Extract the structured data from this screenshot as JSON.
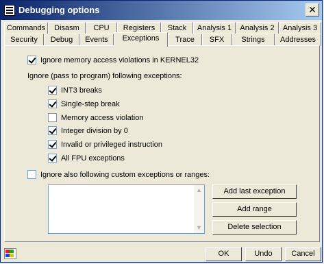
{
  "window": {
    "title": "Debugging options",
    "close_glyph": "✕"
  },
  "tabs_row1": [
    "Commands",
    "Disasm",
    "CPU",
    "Registers",
    "Stack",
    "Analysis 1",
    "Analysis 2",
    "Analysis 3"
  ],
  "tabs_row2": [
    "Security",
    "Debug",
    "Events",
    "Exceptions",
    "Trace",
    "SFX",
    "Strings",
    "Addresses"
  ],
  "active_tab": "Exceptions",
  "exceptions": {
    "ignore_kernel32": {
      "label": "Ignore memory access violations in KERNEL32",
      "checked": true
    },
    "ignore_heading": "Ignore (pass to program) following exceptions:",
    "items": [
      {
        "label": "INT3 breaks",
        "checked": true
      },
      {
        "label": "Single-step break",
        "checked": true
      },
      {
        "label": "Memory access violation",
        "checked": false
      },
      {
        "label": "Integer division by 0",
        "checked": true
      },
      {
        "label": "Invalid or privileged instruction",
        "checked": true
      },
      {
        "label": "All FPU exceptions",
        "checked": true
      }
    ],
    "ignore_custom": {
      "label": "Ignore also following custom exceptions or ranges:",
      "checked": false
    }
  },
  "custom_buttons": {
    "add_last": "Add last exception",
    "add_range": "Add range",
    "delete_selection": "Delete selection"
  },
  "footer": {
    "ok": "OK",
    "undo": "Undo",
    "cancel": "Cancel"
  },
  "colors": {
    "title_start": "#0a246a",
    "title_end": "#a6caf0",
    "face": "#ece9d8"
  },
  "icons": {
    "app": "list-icon",
    "close": "close-icon",
    "scroll_up": "scroll-up-icon",
    "scroll_down": "scroll-down-icon",
    "palette": "color-palette-icon"
  }
}
